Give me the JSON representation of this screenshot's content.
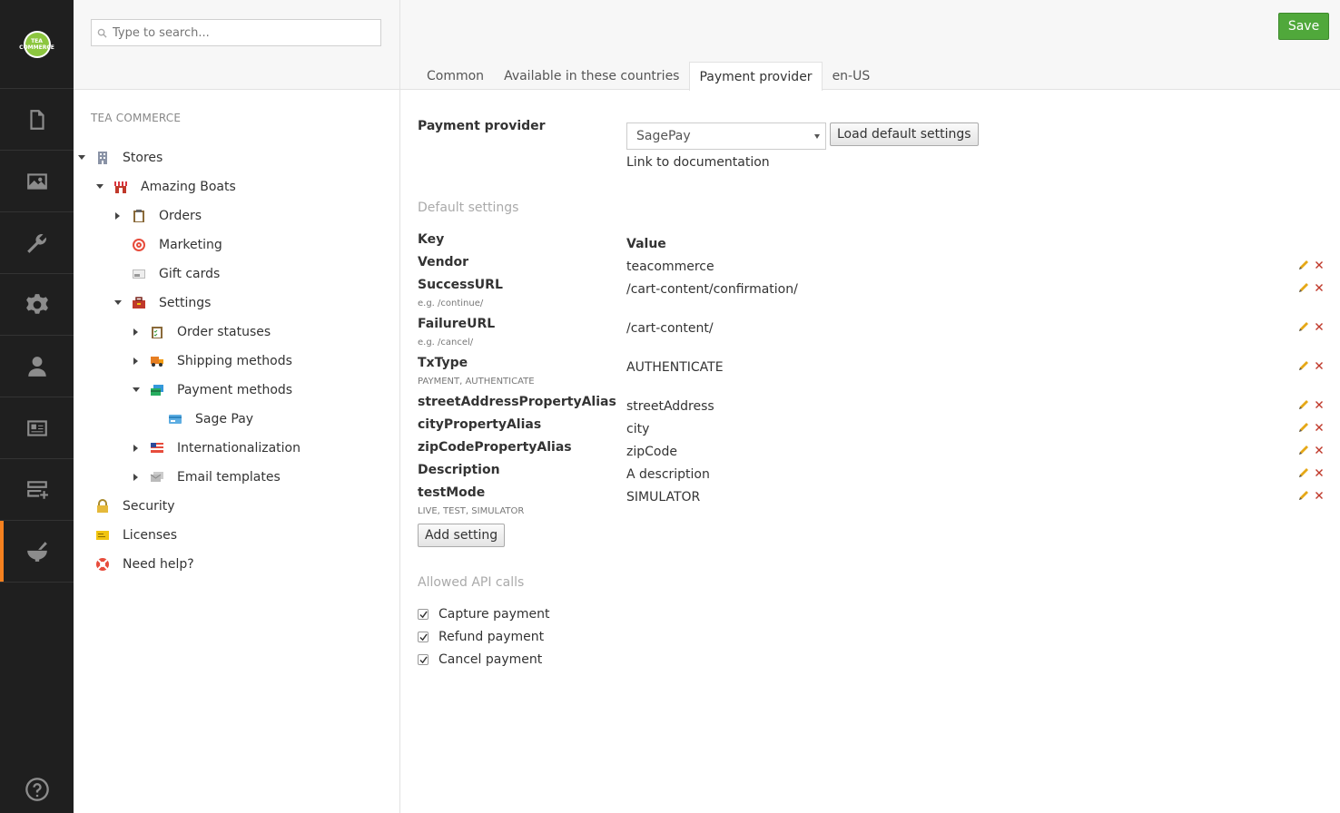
{
  "brand": {
    "logo_text": "TEA COMMERCE",
    "accent": "#f5811f",
    "save_color": "#50a83b"
  },
  "appbar": {
    "sections": [
      {
        "icon": "document-icon"
      },
      {
        "icon": "image-icon"
      },
      {
        "icon": "wrench-icon"
      },
      {
        "icon": "gear-icon"
      },
      {
        "icon": "user-icon"
      },
      {
        "icon": "id-card-icon"
      },
      {
        "icon": "add-section-icon"
      },
      {
        "icon": "mortar-pestle-icon",
        "active": true
      }
    ],
    "help_icon": "question-icon"
  },
  "tree": {
    "search_placeholder": "Type to search...",
    "title": "TEA COMMERCE",
    "nodes": [
      {
        "label": "Stores",
        "level": 0,
        "caret": "down",
        "icon": "building-icon"
      },
      {
        "label": "Amazing Boats",
        "level": 1,
        "caret": "down",
        "icon": "store-icon"
      },
      {
        "label": "Orders",
        "level": 2,
        "caret": "right",
        "icon": "clipboard-icon"
      },
      {
        "label": "Marketing",
        "level": 2,
        "caret": "none",
        "icon": "target-icon"
      },
      {
        "label": "Gift cards",
        "level": 2,
        "caret": "none",
        "icon": "gift-card-icon"
      },
      {
        "label": "Settings",
        "level": 2,
        "caret": "down",
        "icon": "toolbox-icon"
      },
      {
        "label": "Order statuses",
        "level": 3,
        "caret": "right",
        "icon": "checklist-icon"
      },
      {
        "label": "Shipping methods",
        "level": 3,
        "caret": "right",
        "icon": "truck-icon"
      },
      {
        "label": "Payment methods",
        "level": 3,
        "caret": "down",
        "icon": "cards-icon"
      },
      {
        "label": "Sage Pay",
        "level": 4,
        "caret": "none",
        "icon": "credit-card-icon"
      },
      {
        "label": "Internationalization",
        "level": 3,
        "caret": "right",
        "icon": "flag-icon"
      },
      {
        "label": "Email templates",
        "level": 3,
        "caret": "right",
        "icon": "email-icon"
      },
      {
        "label": "Security",
        "level": 0,
        "caret": "none",
        "icon": "lock-icon"
      },
      {
        "label": "Licenses",
        "level": 0,
        "caret": "none",
        "icon": "license-icon"
      },
      {
        "label": "Need help?",
        "level": 0,
        "caret": "none",
        "icon": "lifebuoy-icon"
      }
    ]
  },
  "header": {
    "save_label": "Save",
    "tabs": [
      {
        "label": "Common"
      },
      {
        "label": "Available in these countries"
      },
      {
        "label": "Payment provider",
        "active": true
      },
      {
        "label": "en-US"
      }
    ]
  },
  "form": {
    "provider_label": "Payment provider",
    "provider_value": "SagePay",
    "load_defaults_label": "Load default settings",
    "doc_link": "Link to documentation",
    "default_settings_title": "Default settings",
    "key_header": "Key",
    "value_header": "Value",
    "settings": [
      {
        "key": "Vendor",
        "hint": "",
        "value": "teacommerce"
      },
      {
        "key": "SuccessURL",
        "hint": "e.g. /continue/",
        "value": "/cart-content/confirmation/"
      },
      {
        "key": "FailureURL",
        "hint": "e.g. /cancel/",
        "value": "/cart-content/"
      },
      {
        "key": "TxType",
        "hint": "PAYMENT, AUTHENTICATE",
        "value": "AUTHENTICATE"
      },
      {
        "key": "streetAddressPropertyAlias",
        "hint": "",
        "value": "streetAddress"
      },
      {
        "key": "cityPropertyAlias",
        "hint": "",
        "value": "city"
      },
      {
        "key": "zipCodePropertyAlias",
        "hint": "",
        "value": "zipCode"
      },
      {
        "key": "Description",
        "hint": "",
        "value": "A description"
      },
      {
        "key": "testMode",
        "hint": "LIVE, TEST, SIMULATOR",
        "value": "SIMULATOR"
      }
    ],
    "add_setting_label": "Add setting",
    "allowed_api_title": "Allowed API calls",
    "api_calls": [
      {
        "label": "Capture payment",
        "checked": true
      },
      {
        "label": "Refund payment",
        "checked": true
      },
      {
        "label": "Cancel payment",
        "checked": true
      }
    ]
  }
}
